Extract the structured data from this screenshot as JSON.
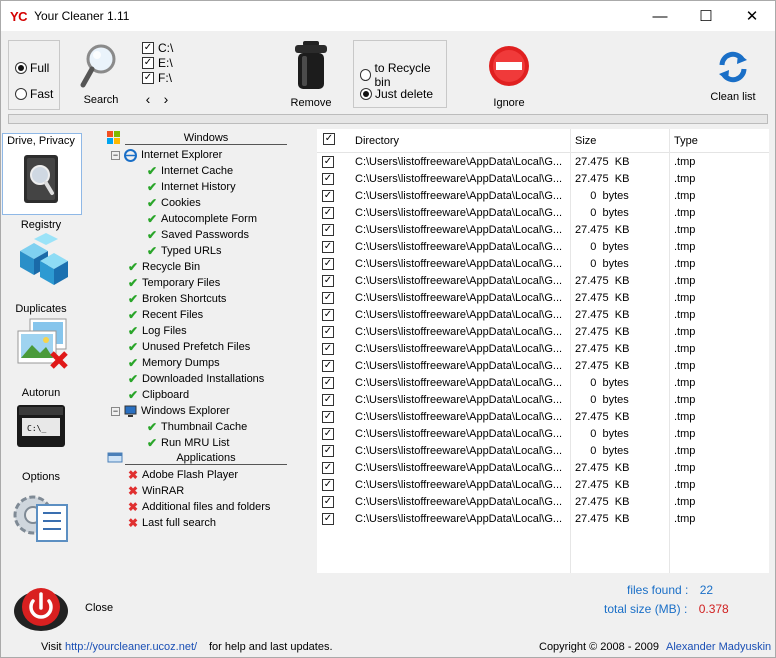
{
  "window": {
    "logo": "YC",
    "title": "Your Cleaner 1.11",
    "minimize_glyph": "—",
    "maximize_glyph": "☐",
    "close_glyph": "✕"
  },
  "toolbar": {
    "mode_full": "Full",
    "mode_fast": "Fast",
    "search_label": "Search",
    "drives": [
      "C:\\",
      "E:\\",
      "F:\\"
    ],
    "remove_label": "Remove",
    "to_recycle_bin": "to Recycle bin",
    "just_delete": "Just delete",
    "ignore_label": "Ignore",
    "clean_list_label": "Clean list",
    "prev_glyph": "‹",
    "next_glyph": "›"
  },
  "sidebar": {
    "drive_privacy": "Drive, Privacy",
    "registry": "Registry",
    "duplicates": "Duplicates",
    "autorun": "Autorun",
    "options": "Options",
    "close": "Close"
  },
  "tree": {
    "windows_head": "Windows",
    "ie": "Internet Explorer",
    "ie_items": [
      "Internet Cache",
      "Internet History",
      "Cookies",
      "Autocomplete Form",
      "Saved Passwords",
      "Typed URLs"
    ],
    "win_items": [
      "Recycle Bin",
      "Temporary Files",
      "Broken Shortcuts",
      "Recent Files",
      "Log Files",
      "Unused Prefetch Files",
      "Memory Dumps",
      "Downloaded Installations",
      "Clipboard"
    ],
    "explorer": "Windows Explorer",
    "explorer_items": [
      "Thumbnail Cache",
      "Run MRU List"
    ],
    "apps_head": "Applications",
    "app_items": [
      "Adobe Flash Player",
      "WinRAR",
      "Additional files and folders",
      "Last full search"
    ]
  },
  "table": {
    "headers": {
      "directory": "Directory",
      "size": "Size",
      "type": "Type"
    },
    "rows": [
      {
        "dir": "C:\\Users\\listoffreeware\\AppData\\Local\\G...",
        "size": "27.475  KB",
        "type": ".tmp"
      },
      {
        "dir": "C:\\Users\\listoffreeware\\AppData\\Local\\G...",
        "size": "27.475  KB",
        "type": ".tmp"
      },
      {
        "dir": "C:\\Users\\listoffreeware\\AppData\\Local\\G...",
        "size": "     0  bytes",
        "type": ".tmp"
      },
      {
        "dir": "C:\\Users\\listoffreeware\\AppData\\Local\\G...",
        "size": "     0  bytes",
        "type": ".tmp"
      },
      {
        "dir": "C:\\Users\\listoffreeware\\AppData\\Local\\G...",
        "size": "27.475  KB",
        "type": ".tmp"
      },
      {
        "dir": "C:\\Users\\listoffreeware\\AppData\\Local\\G...",
        "size": "     0  bytes",
        "type": ".tmp"
      },
      {
        "dir": "C:\\Users\\listoffreeware\\AppData\\Local\\G...",
        "size": "     0  bytes",
        "type": ".tmp"
      },
      {
        "dir": "C:\\Users\\listoffreeware\\AppData\\Local\\G...",
        "size": "27.475  KB",
        "type": ".tmp"
      },
      {
        "dir": "C:\\Users\\listoffreeware\\AppData\\Local\\G...",
        "size": "27.475  KB",
        "type": ".tmp"
      },
      {
        "dir": "C:\\Users\\listoffreeware\\AppData\\Local\\G...",
        "size": "27.475  KB",
        "type": ".tmp"
      },
      {
        "dir": "C:\\Users\\listoffreeware\\AppData\\Local\\G...",
        "size": "27.475  KB",
        "type": ".tmp"
      },
      {
        "dir": "C:\\Users\\listoffreeware\\AppData\\Local\\G...",
        "size": "27.475  KB",
        "type": ".tmp"
      },
      {
        "dir": "C:\\Users\\listoffreeware\\AppData\\Local\\G...",
        "size": "27.475  KB",
        "type": ".tmp"
      },
      {
        "dir": "C:\\Users\\listoffreeware\\AppData\\Local\\G...",
        "size": "     0  bytes",
        "type": ".tmp"
      },
      {
        "dir": "C:\\Users\\listoffreeware\\AppData\\Local\\G...",
        "size": "     0  bytes",
        "type": ".tmp"
      },
      {
        "dir": "C:\\Users\\listoffreeware\\AppData\\Local\\G...",
        "size": "27.475  KB",
        "type": ".tmp"
      },
      {
        "dir": "C:\\Users\\listoffreeware\\AppData\\Local\\G...",
        "size": "     0  bytes",
        "type": ".tmp"
      },
      {
        "dir": "C:\\Users\\listoffreeware\\AppData\\Local\\G...",
        "size": "     0  bytes",
        "type": ".tmp"
      },
      {
        "dir": "C:\\Users\\listoffreeware\\AppData\\Local\\G...",
        "size": "27.475  KB",
        "type": ".tmp"
      },
      {
        "dir": "C:\\Users\\listoffreeware\\AppData\\Local\\G...",
        "size": "27.475  KB",
        "type": ".tmp"
      },
      {
        "dir": "C:\\Users\\listoffreeware\\AppData\\Local\\G...",
        "size": "27.475  KB",
        "type": ".tmp"
      },
      {
        "dir": "C:\\Users\\listoffreeware\\AppData\\Local\\G...",
        "size": "27.475  KB",
        "type": ".tmp"
      }
    ]
  },
  "stats": {
    "files_found_label": "files found :",
    "files_found_value": "22",
    "total_size_label": "total size (MB) :",
    "total_size_value": "0.378"
  },
  "footer": {
    "visit": "Visit",
    "url": "http://yourcleaner.ucoz.net/",
    "help": "for help and last updates.",
    "copyright": "Copyright © 2008 - 2009",
    "author": "Alexander Madyuskin"
  },
  "colors": {
    "accent_blue": "#1a6fc7",
    "size_red": "#d02020",
    "tick_green": "#2aa52a",
    "cross_red": "#e03030"
  }
}
